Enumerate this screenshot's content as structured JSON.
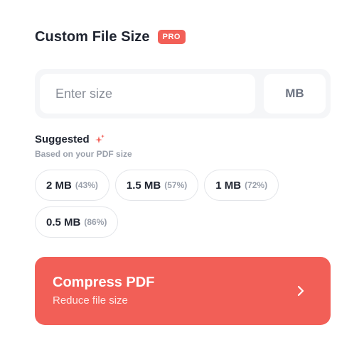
{
  "header": {
    "title": "Custom File Size",
    "badge": "PRO"
  },
  "size_input": {
    "placeholder": "Enter size",
    "value": "",
    "unit": "MB"
  },
  "suggested": {
    "title": "Suggested",
    "subtitle": "Based on your PDF size",
    "icon": "sparkle-icon",
    "options": [
      {
        "size": "2 MB",
        "reduction": "(43%)"
      },
      {
        "size": "1.5 MB",
        "reduction": "(57%)"
      },
      {
        "size": "1 MB",
        "reduction": "(72%)"
      },
      {
        "size": "0.5 MB",
        "reduction": "(86%)"
      }
    ]
  },
  "action": {
    "title": "Compress PDF",
    "subtitle": "Reduce file size",
    "icon": "chevron-right-icon"
  },
  "colors": {
    "accent": "#f25f57",
    "text": "#1f2430",
    "muted": "#9aa0ab"
  }
}
